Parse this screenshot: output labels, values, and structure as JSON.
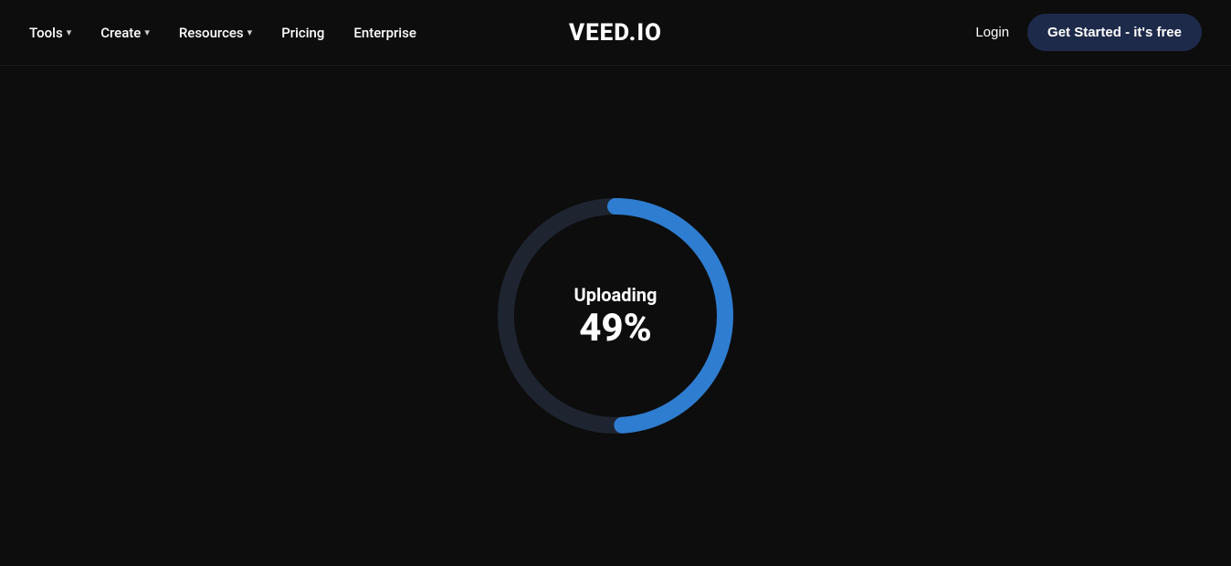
{
  "navbar": {
    "logo": "VEED.IO",
    "nav_items": [
      {
        "label": "Tools",
        "has_dropdown": true
      },
      {
        "label": "Create",
        "has_dropdown": true
      },
      {
        "label": "Resources",
        "has_dropdown": true
      },
      {
        "label": "Pricing",
        "has_dropdown": false
      },
      {
        "label": "Enterprise",
        "has_dropdown": false
      }
    ],
    "login_label": "Login",
    "get_started_label": "Get Started - it's free"
  },
  "main": {
    "uploading_label": "Uploading",
    "percent_label": "49%",
    "progress_value": 49,
    "colors": {
      "bg": "#0d0d0d",
      "circle_bg": "#1e2530",
      "arc": "#2e7dd1",
      "button_bg": "#1e2a4a"
    }
  }
}
